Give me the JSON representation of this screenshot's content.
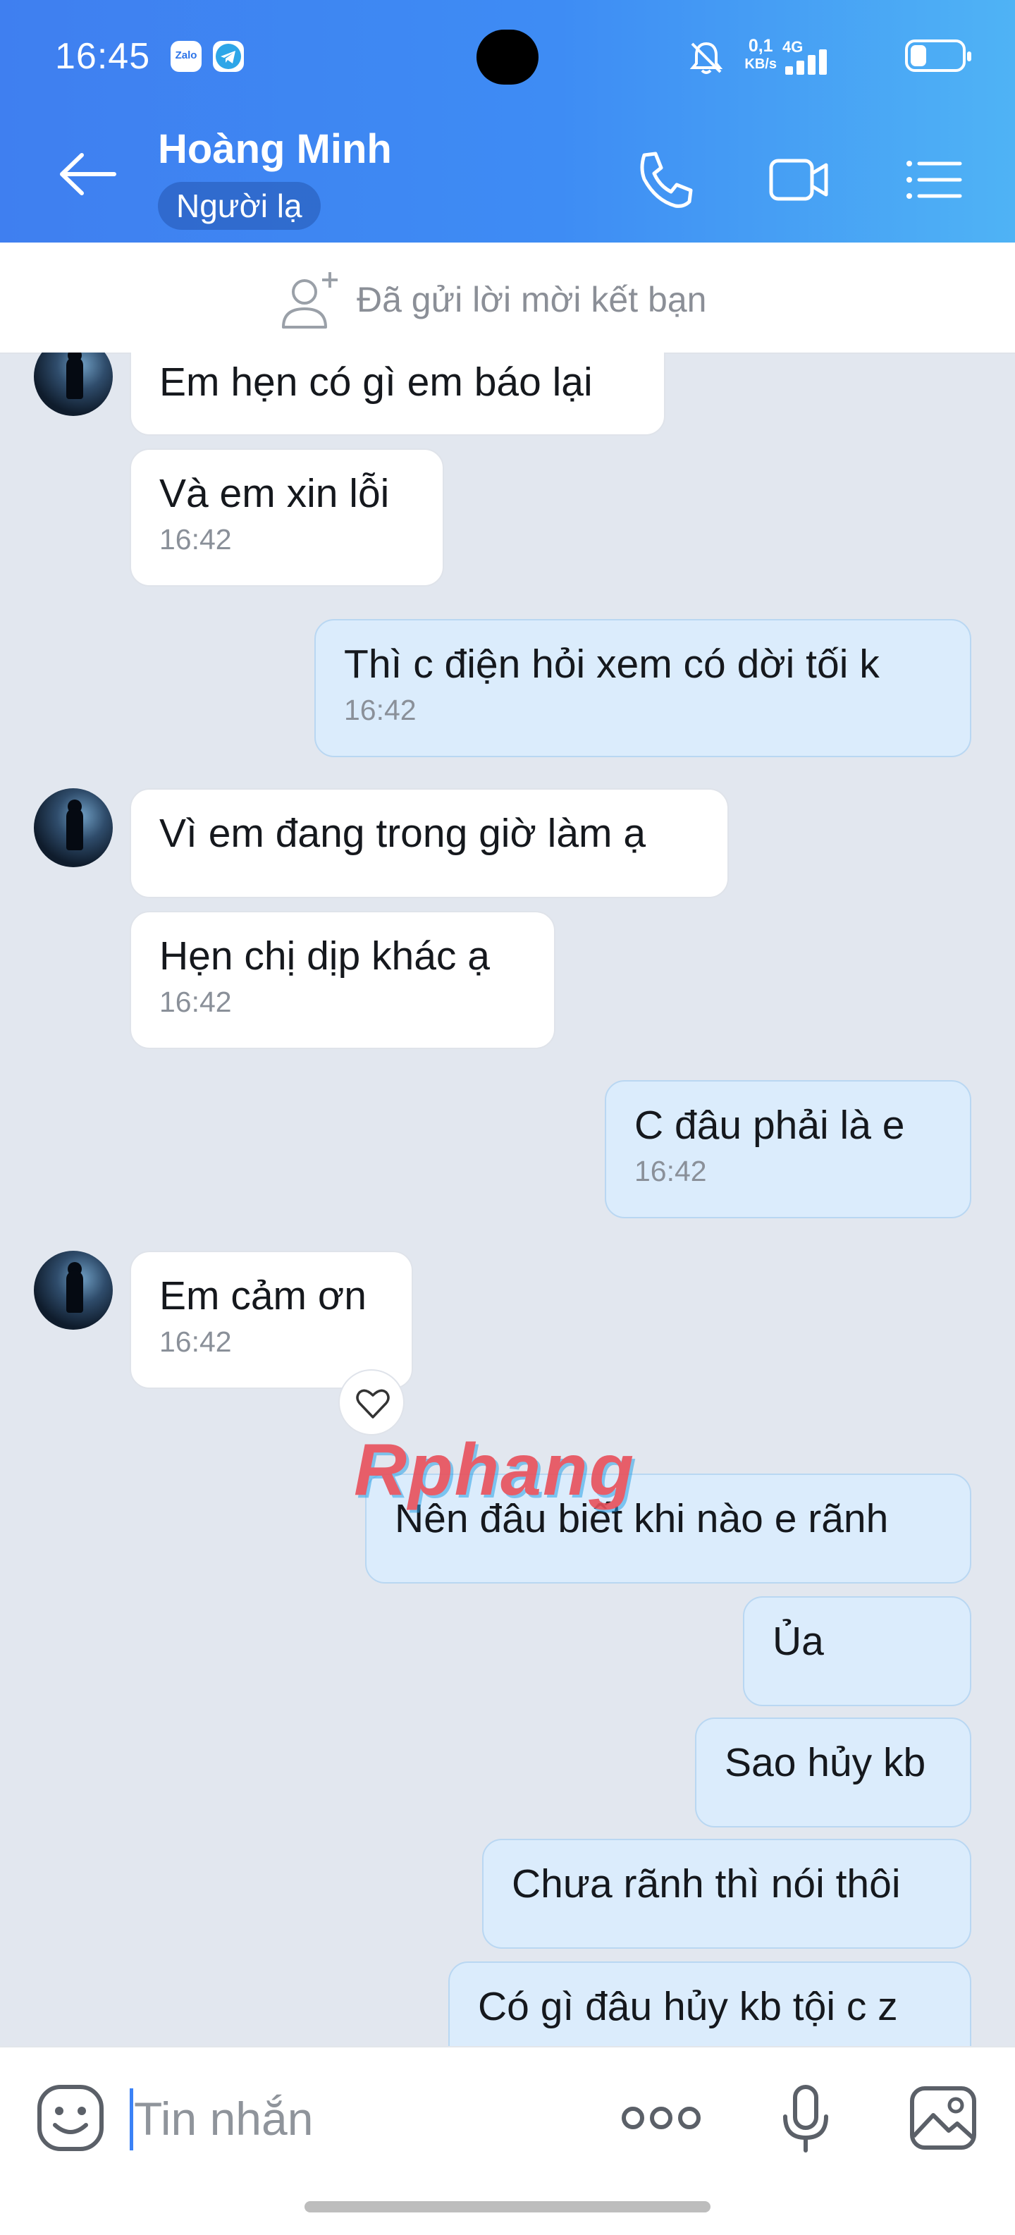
{
  "status_bar": {
    "time": "16:45",
    "app_icons": [
      "zalo-icon",
      "telegram-icon"
    ],
    "zalo_label": "Zalo",
    "net_speed_value": "0,1",
    "net_speed_unit": "KB/s",
    "network": "4G",
    "icons": [
      "bell-off-icon",
      "signal-icon",
      "battery-icon"
    ]
  },
  "header": {
    "contact_name": "Hoàng Minh",
    "badge": "Người lạ",
    "actions": [
      "back-arrow-icon",
      "phone-icon",
      "video-camera-icon",
      "list-menu-icon"
    ],
    "colors": {
      "gradient_start": "#3f7ff0",
      "gradient_end": "#4fb3f5"
    }
  },
  "friend_request": {
    "text": "Đã gửi lời mời kết bạn",
    "icon": "add-friend-icon"
  },
  "messages": [
    {
      "direction": "incoming",
      "text": "Em hẹn có gì em báo lại",
      "time": ""
    },
    {
      "direction": "incoming",
      "text": "Và em xin lỗi",
      "time": "16:42"
    },
    {
      "direction": "outgoing",
      "text": "Thì c điện hỏi xem có dời tối k",
      "time": "16:42"
    },
    {
      "direction": "incoming",
      "text": "Vì em đang trong giờ làm ạ",
      "time": ""
    },
    {
      "direction": "incoming",
      "text": "Hẹn chị dịp khác ạ",
      "time": "16:42"
    },
    {
      "direction": "outgoing",
      "text": "C đâu phải là e",
      "time": "16:42"
    },
    {
      "direction": "incoming",
      "text": "Em cảm ơn",
      "time": "16:42"
    },
    {
      "direction": "outgoing",
      "text": "Nên đâu biết khi nào e rãnh",
      "time": ""
    },
    {
      "direction": "outgoing",
      "text": "Ủa",
      "time": ""
    },
    {
      "direction": "outgoing",
      "text": "Sao hủy kb",
      "time": ""
    },
    {
      "direction": "outgoing",
      "text": "Chưa rãnh thì nói thôi",
      "time": ""
    },
    {
      "direction": "outgoing",
      "text": "Có gì đâu hủy kb tội c z",
      "time": ""
    }
  ],
  "reaction": {
    "icon": "heart-outline-icon"
  },
  "watermark": "Rphang",
  "input_bar": {
    "placeholder": "Tin nhắn",
    "value": "",
    "icons": [
      "emoji-icon",
      "more-dots-icon",
      "microphone-icon",
      "image-icon"
    ]
  },
  "colors": {
    "chat_background": "#e2e7ef",
    "incoming_bubble": "#ffffff",
    "outgoing_bubble": "#dbecfc",
    "timestamp": "#8a9099"
  }
}
